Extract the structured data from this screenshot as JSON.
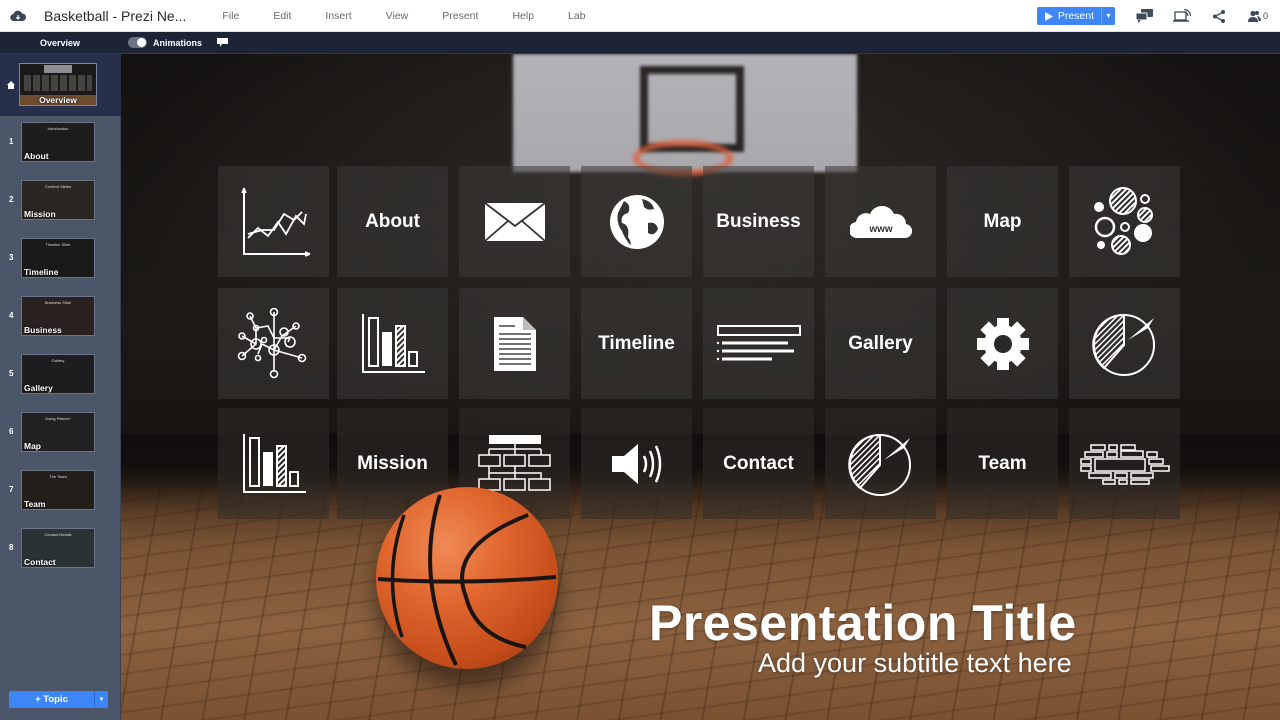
{
  "app": {
    "doc_title": "Basketball - Prezi Ne...",
    "menu": [
      "File",
      "Edit",
      "Insert",
      "View",
      "Present",
      "Help",
      "Lab"
    ],
    "present_label": "Present",
    "collaborators_count": "0",
    "accent_color": "#3e86f5"
  },
  "subbar": {
    "overview_label": "Overview",
    "animations_label": "Animations",
    "animations_on": true
  },
  "sidebar": {
    "overview": {
      "label": "Overview"
    },
    "topics": [
      {
        "num": "1",
        "label": "About",
        "heading": "Introduction"
      },
      {
        "num": "2",
        "label": "Mission",
        "heading": "Content Slides"
      },
      {
        "num": "3",
        "label": "Timeline",
        "heading": "Timeline Slide"
      },
      {
        "num": "4",
        "label": "Business",
        "heading": "Business Slide"
      },
      {
        "num": "5",
        "label": "Gallery",
        "heading": "Gallery"
      },
      {
        "num": "6",
        "label": "Map",
        "heading": "Going Places?"
      },
      {
        "num": "7",
        "label": "Team",
        "heading": "The Team"
      },
      {
        "num": "8",
        "label": "Contact",
        "heading": "Contact Details"
      }
    ],
    "add_topic_label": "+ Topic"
  },
  "canvas": {
    "title": "Presentation Title",
    "subtitle": "Add your subtitle text here",
    "tiles": [
      [
        {
          "type": "icon",
          "icon": "line-chart-icon"
        },
        {
          "type": "text",
          "label": "About"
        },
        {
          "type": "icon",
          "icon": "envelope-icon"
        },
        {
          "type": "icon",
          "icon": "globe-icon"
        },
        {
          "type": "text",
          "label": "Business"
        },
        {
          "type": "icon",
          "icon": "www-cloud-icon",
          "text": "www"
        },
        {
          "type": "text",
          "label": "Map"
        },
        {
          "type": "icon",
          "icon": "bubbles-icon"
        }
      ],
      [
        {
          "type": "icon",
          "icon": "network-icon"
        },
        {
          "type": "icon",
          "icon": "bar-chart-icon"
        },
        {
          "type": "icon",
          "icon": "document-icon"
        },
        {
          "type": "text",
          "label": "Timeline"
        },
        {
          "type": "icon",
          "icon": "list-icon"
        },
        {
          "type": "text",
          "label": "Gallery"
        },
        {
          "type": "icon",
          "icon": "gear-icon"
        },
        {
          "type": "icon",
          "icon": "pie-chart-icon"
        }
      ],
      [
        {
          "type": "icon",
          "icon": "bar-chart-icon"
        },
        {
          "type": "text",
          "label": "Mission"
        },
        {
          "type": "icon",
          "icon": "org-chart-icon"
        },
        {
          "type": "icon",
          "icon": "speaker-icon"
        },
        {
          "type": "text",
          "label": "Contact"
        },
        {
          "type": "icon",
          "icon": "pie-chart-icon"
        },
        {
          "type": "text",
          "label": "Team"
        },
        {
          "type": "icon",
          "icon": "bricks-icon"
        }
      ]
    ]
  }
}
